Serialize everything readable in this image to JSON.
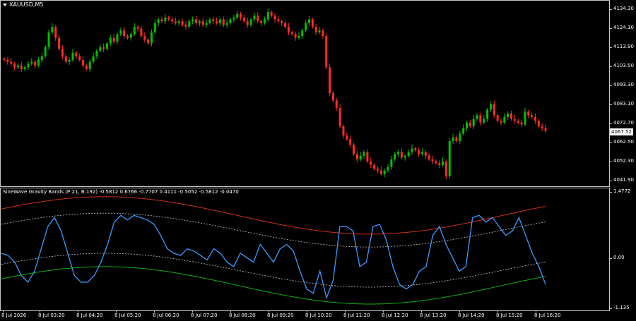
{
  "window": {
    "symbol_label": "XAUUSD,M5"
  },
  "indicator": {
    "label": "SineWave Gravity Bands (P:21, B:192) -0.5812 0.6766 -0.7707 0.4111 -0.5052 -0.5812 -0.0470"
  },
  "price_axis": {
    "labels": [
      "4134.30",
      "4124.10",
      "4113.90",
      "4103.50",
      "4093.30",
      "4083.10",
      "4072.70",
      "4062.50",
      "4052.30",
      "4041.90"
    ],
    "current_price": "4067.52"
  },
  "indicator_axis": {
    "labels": [
      "1.4772",
      "0.00",
      "-1.135"
    ]
  },
  "time_axis": {
    "labels": [
      "8 Jul 2026",
      "8 Jul 03:20",
      "8 Jul 04:20",
      "8 Jul 05:20",
      "8 Jul 06:20",
      "8 Jul 07:20",
      "8 Jul 08:20",
      "8 Jul 09:20",
      "8 Jul 10:20",
      "8 Jul 11:20",
      "8 Jul 12:20",
      "8 Jul 13:20",
      "8 Jul 14:20",
      "8 Jul 15:20",
      "8 Jul 16:20"
    ]
  },
  "colors": {
    "background": "#000000",
    "bull": "#00c000",
    "bear": "#ff2a2a",
    "sine_line": "#3d9aff",
    "upper_band": "#d03018",
    "lower_band": "#10b010",
    "mid_bands": "#c8c8c8"
  },
  "chart_data": [
    {
      "type": "candlestick",
      "symbol": "XAUUSD",
      "timeframe": "M5",
      "ylim": [
        4039,
        4137
      ],
      "current_price": 4067.52,
      "close": [
        4106,
        4105,
        4104,
        4102,
        4103,
        4101,
        4102,
        4104,
        4105,
        4103,
        4106,
        4108,
        4113,
        4121,
        4124,
        4118,
        4112,
        4108,
        4105,
        4106,
        4110,
        4108,
        4106,
        4103,
        4101,
        4105,
        4108,
        4111,
        4113,
        4112,
        4115,
        4118,
        4116,
        4120,
        4122,
        4119,
        4118,
        4120,
        4124,
        4123,
        4119,
        4117,
        4115,
        4121,
        4126,
        4128,
        4127,
        4129,
        4128,
        4127,
        4126,
        4127,
        4125,
        4124,
        4127,
        4128,
        4126,
        4127,
        4125,
        4126,
        4128,
        4127,
        4126,
        4128,
        4125,
        4126,
        4128,
        4129,
        4131,
        4129,
        4127,
        4125,
        4128,
        4130,
        4127,
        4126,
        4128,
        4132,
        4130,
        4128,
        4127,
        4126,
        4124,
        4121,
        4120,
        4118,
        4119,
        4122,
        4126,
        4128,
        4124,
        4121,
        4122,
        4119,
        4102,
        4088,
        4084,
        4080,
        4070,
        4065,
        4063,
        4060,
        4055,
        4052,
        4054,
        4056,
        4051,
        4049,
        4047,
        4046,
        4044,
        4046,
        4048,
        4052,
        4055,
        4056,
        4053,
        4054,
        4056,
        4058,
        4057,
        4055,
        4056,
        4054,
        4052,
        4051,
        4050,
        4049,
        4051,
        4043,
        4062,
        4064,
        4062,
        4066,
        4069,
        4072,
        4070,
        4074,
        4076,
        4072,
        4074,
        4079,
        4082,
        4076,
        4073,
        4072,
        4075,
        4077,
        4074,
        4073,
        4072,
        4071,
        4078,
        4076,
        4075,
        4073,
        4070,
        4069,
        4067.52
      ],
      "open_high_low": "omitted: approximated by rendering script from close series"
    },
    {
      "type": "line",
      "name": "SineWave Gravity Bands (P:21, B:192)",
      "ylim": [
        -1.135,
        1.4772
      ],
      "values_shown": [
        -0.5812,
        0.6766,
        -0.7707,
        0.4111,
        -0.5052,
        -0.5812,
        -0.047
      ],
      "sine": [
        0.1,
        0.05,
        -0.1,
        -0.4,
        -0.55,
        -0.3,
        0.2,
        0.7,
        0.9,
        0.6,
        0.1,
        -0.4,
        -0.55,
        -0.55,
        -0.4,
        -0.1,
        0.3,
        0.8,
        0.95,
        0.85,
        0.95,
        0.9,
        0.85,
        0.75,
        0.5,
        0.2,
        0.1,
        0.05,
        0.2,
        0.15,
        0.05,
        -0.05,
        0.2,
        0.1,
        -0.1,
        -0.2,
        0.1,
        0.0,
        -0.1,
        0.3,
        0.1,
        -0.1,
        0.2,
        0.3,
        0.15,
        -0.3,
        -0.7,
        -0.8,
        -0.3,
        -0.9,
        -0.5,
        0.7,
        0.7,
        0.6,
        -0.2,
        -0.1,
        0.7,
        0.75,
        0.4,
        -0.2,
        -0.6,
        -0.7,
        -0.6,
        -0.3,
        -0.2,
        0.5,
        0.7,
        0.3,
        0.0,
        -0.3,
        -0.2,
        0.9,
        0.95,
        0.8,
        0.9,
        0.7,
        0.5,
        0.6,
        0.9,
        0.5,
        0.1,
        -0.2,
        -0.6
      ]
    }
  ]
}
